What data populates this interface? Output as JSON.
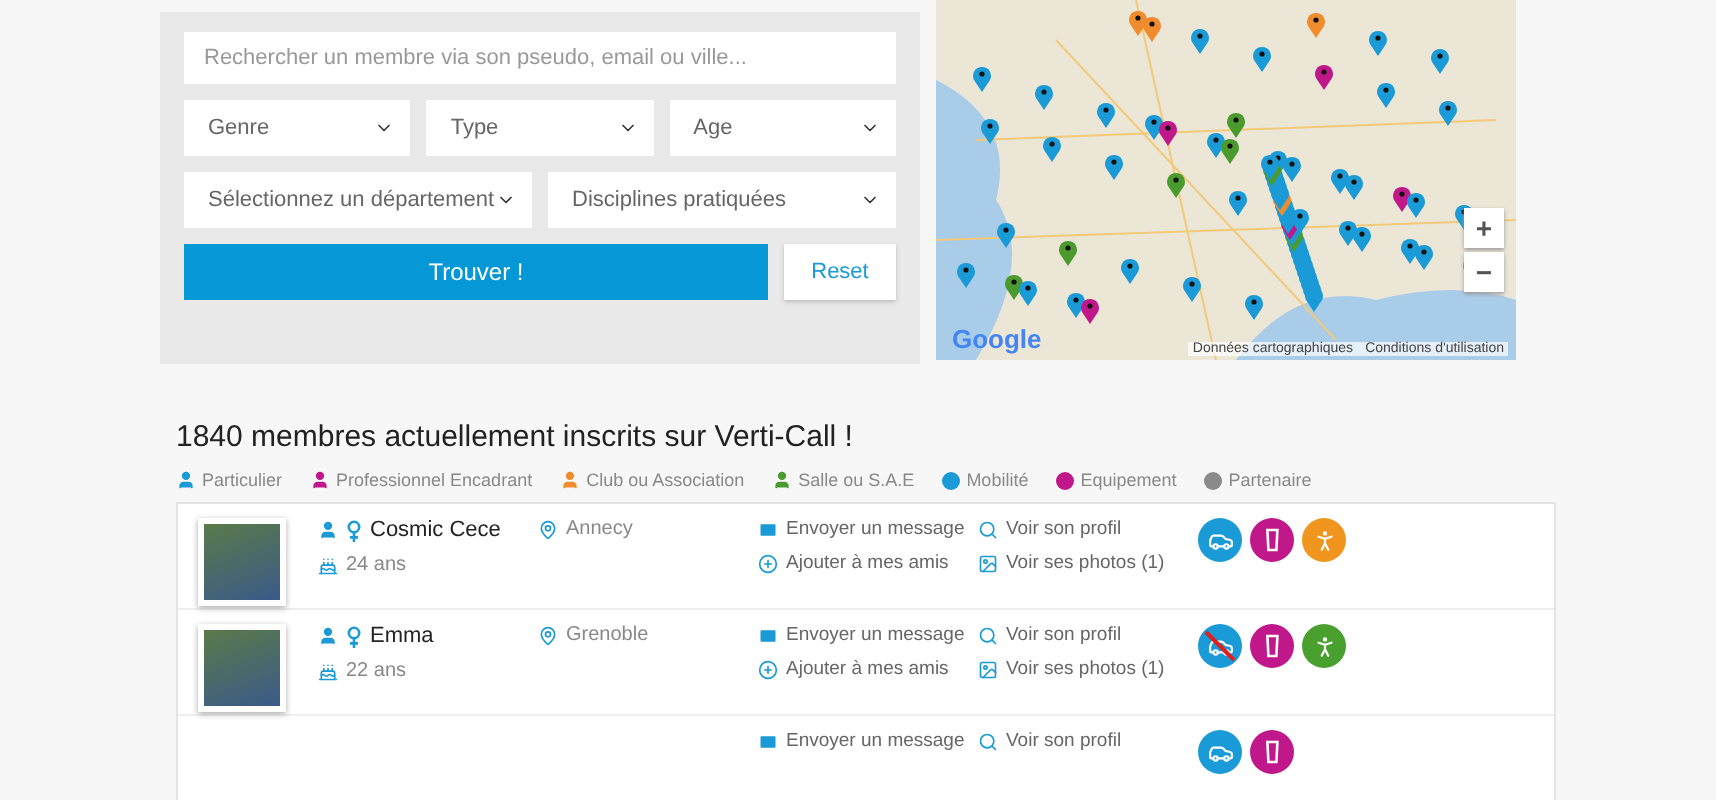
{
  "search_panel": {
    "search": {
      "placeholder": "Rechercher un membre via son pseudo, email ou ville..."
    },
    "selects": [
      {
        "placeholder": "Genre"
      },
      {
        "placeholder": "Type"
      },
      {
        "placeholder": "Age"
      },
      {
        "placeholder": "Sélectionnez un département"
      },
      {
        "placeholder": "Disciplines pratiquées"
      }
    ],
    "find_button": "Trouver !",
    "reset_button": "Reset"
  },
  "map": {
    "zoom_in": "+",
    "zoom_out": "−",
    "attribution": "Données cartographiques",
    "terms": "Conditions d'utilisation",
    "logo": "Google"
  },
  "members_title": "1840 membres actuellement inscrits sur Verti-Call !",
  "legend": [
    {
      "label": "Particulier",
      "kind": "person",
      "color": "#1a9ad6"
    },
    {
      "label": "Professionnel Encadrant",
      "kind": "person",
      "color": "#c0188a"
    },
    {
      "label": "Club ou Association",
      "kind": "person",
      "color": "#f08c2e"
    },
    {
      "label": "Salle ou S.A.E",
      "kind": "person",
      "color": "#4a9a2e"
    },
    {
      "label": "Mobilité",
      "kind": "round",
      "color": "#1a9ad6"
    },
    {
      "label": "Equipement",
      "kind": "round",
      "color": "#c0188a"
    },
    {
      "label": "Partenaire",
      "kind": "round",
      "color": "#8a8a8a"
    }
  ],
  "members": [
    {
      "name": "Cosmic Cece",
      "age": "24 ans",
      "city": "Annecy",
      "actions": [
        {
          "kind": "message",
          "label": "Envoyer un message"
        },
        {
          "kind": "friend",
          "label": "Ajouter à mes amis"
        }
      ],
      "links": [
        {
          "kind": "profile",
          "label": "Voir son profil"
        },
        {
          "kind": "photos",
          "label": "Voir ses photos (1)"
        }
      ],
      "badges": [
        {
          "kind": "car"
        },
        {
          "kind": "quickdraw"
        },
        {
          "kind": "club"
        }
      ]
    },
    {
      "name": "Emma",
      "age": "22 ans",
      "city": "Grenoble",
      "actions": [
        {
          "kind": "message",
          "label": "Envoyer un message"
        },
        {
          "kind": "friend",
          "label": "Ajouter à mes amis"
        }
      ],
      "links": [
        {
          "kind": "profile",
          "label": "Voir son profil"
        },
        {
          "kind": "photos",
          "label": "Voir ses photos (1)"
        }
      ],
      "badges": [
        {
          "kind": "nocar"
        },
        {
          "kind": "quickdraw"
        },
        {
          "kind": "hall"
        }
      ]
    },
    {
      "actions": [
        {
          "kind": "message",
          "label": "Envoyer un message"
        }
      ],
      "links": [
        {
          "kind": "profile",
          "label": "Voir son profil"
        }
      ],
      "badges": [
        {
          "kind": "car"
        },
        {
          "kind": "quickdraw"
        }
      ]
    }
  ]
}
